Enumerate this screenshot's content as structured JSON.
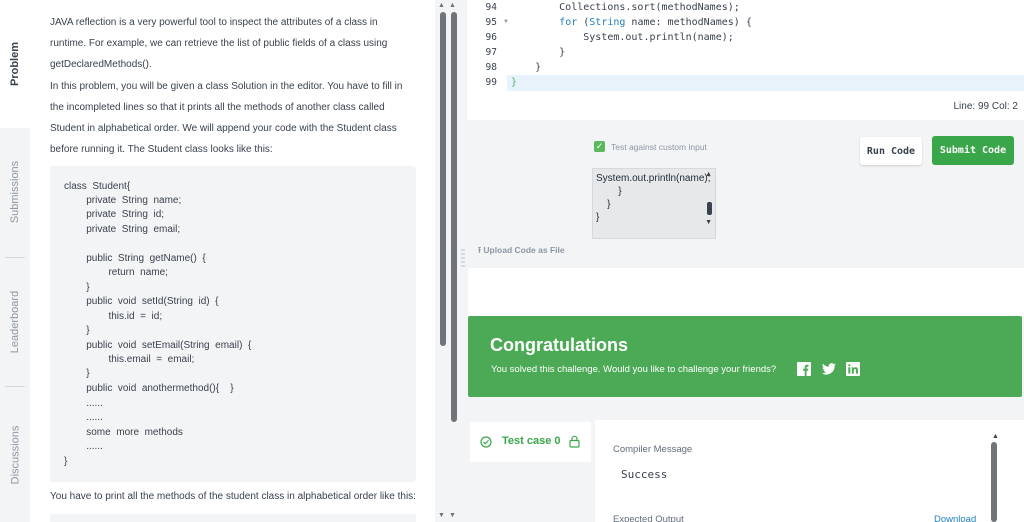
{
  "tabs": [
    {
      "label": "Problem",
      "active": true
    },
    {
      "label": "Submissions",
      "active": false
    },
    {
      "label": "Leaderboard",
      "active": false
    },
    {
      "label": "Discussions",
      "active": false
    }
  ],
  "problem": {
    "para1_lines": [
      "JAVA reflection is a very powerful tool to inspect the attributes of a class in",
      "runtime. For example, we can retrieve the list of public fields of a class using",
      "getDeclaredMethods()."
    ],
    "para2_lines": [
      "In this problem, you will be given a class Solution in the editor. You have to fill in",
      "the incompleted lines so that it prints all the methods of another class called",
      "Student in alphabetical order. We will append your code with the Student class",
      "before running it. The Student class looks like this:"
    ],
    "code_lines": [
      "class  Student{",
      "        private  String  name;",
      "        private  String  id;",
      "        private  String  email;",
      "",
      "        public  String  getName()  {",
      "                return  name;",
      "        }",
      "        public  void  setId(String  id)  {",
      "                this.id  =  id;",
      "        }",
      "        public  void  setEmail(String  email)  {",
      "                this.email  =  email;",
      "        }",
      "        public  void  anothermethod(){    }",
      "        ......",
      "        ......",
      "        some  more  methods",
      "        ......",
      "}"
    ],
    "para3": "You have to print all the methods of the student class in alphabetical order like this:"
  },
  "editor": {
    "line_numbers": [
      "94",
      "95",
      "96",
      "97",
      "98",
      "99"
    ],
    "status": "Line: 99 Col: 2"
  },
  "controls": {
    "checkbox_label": "Test against custom input",
    "run_label": "Run Code",
    "submit_label": "Submit Code",
    "custom_input": "System.out.println(name);\n        }\n    }\n}",
    "upload_label": "Upload Code as File"
  },
  "congrats": {
    "title": "Congratulations",
    "subtitle": "You solved this challenge. Would you like to challenge your friends?"
  },
  "testcase": {
    "label": "Test case 0"
  },
  "results": {
    "compiler_label": "Compiler Message",
    "compiler_value": "Success",
    "expected_label": "Expected Output",
    "download_label": "Download"
  },
  "colors": {
    "accent_green": "#39a64a",
    "congrats_green": "#4caa56",
    "link_blue": "#1e7fc2"
  }
}
